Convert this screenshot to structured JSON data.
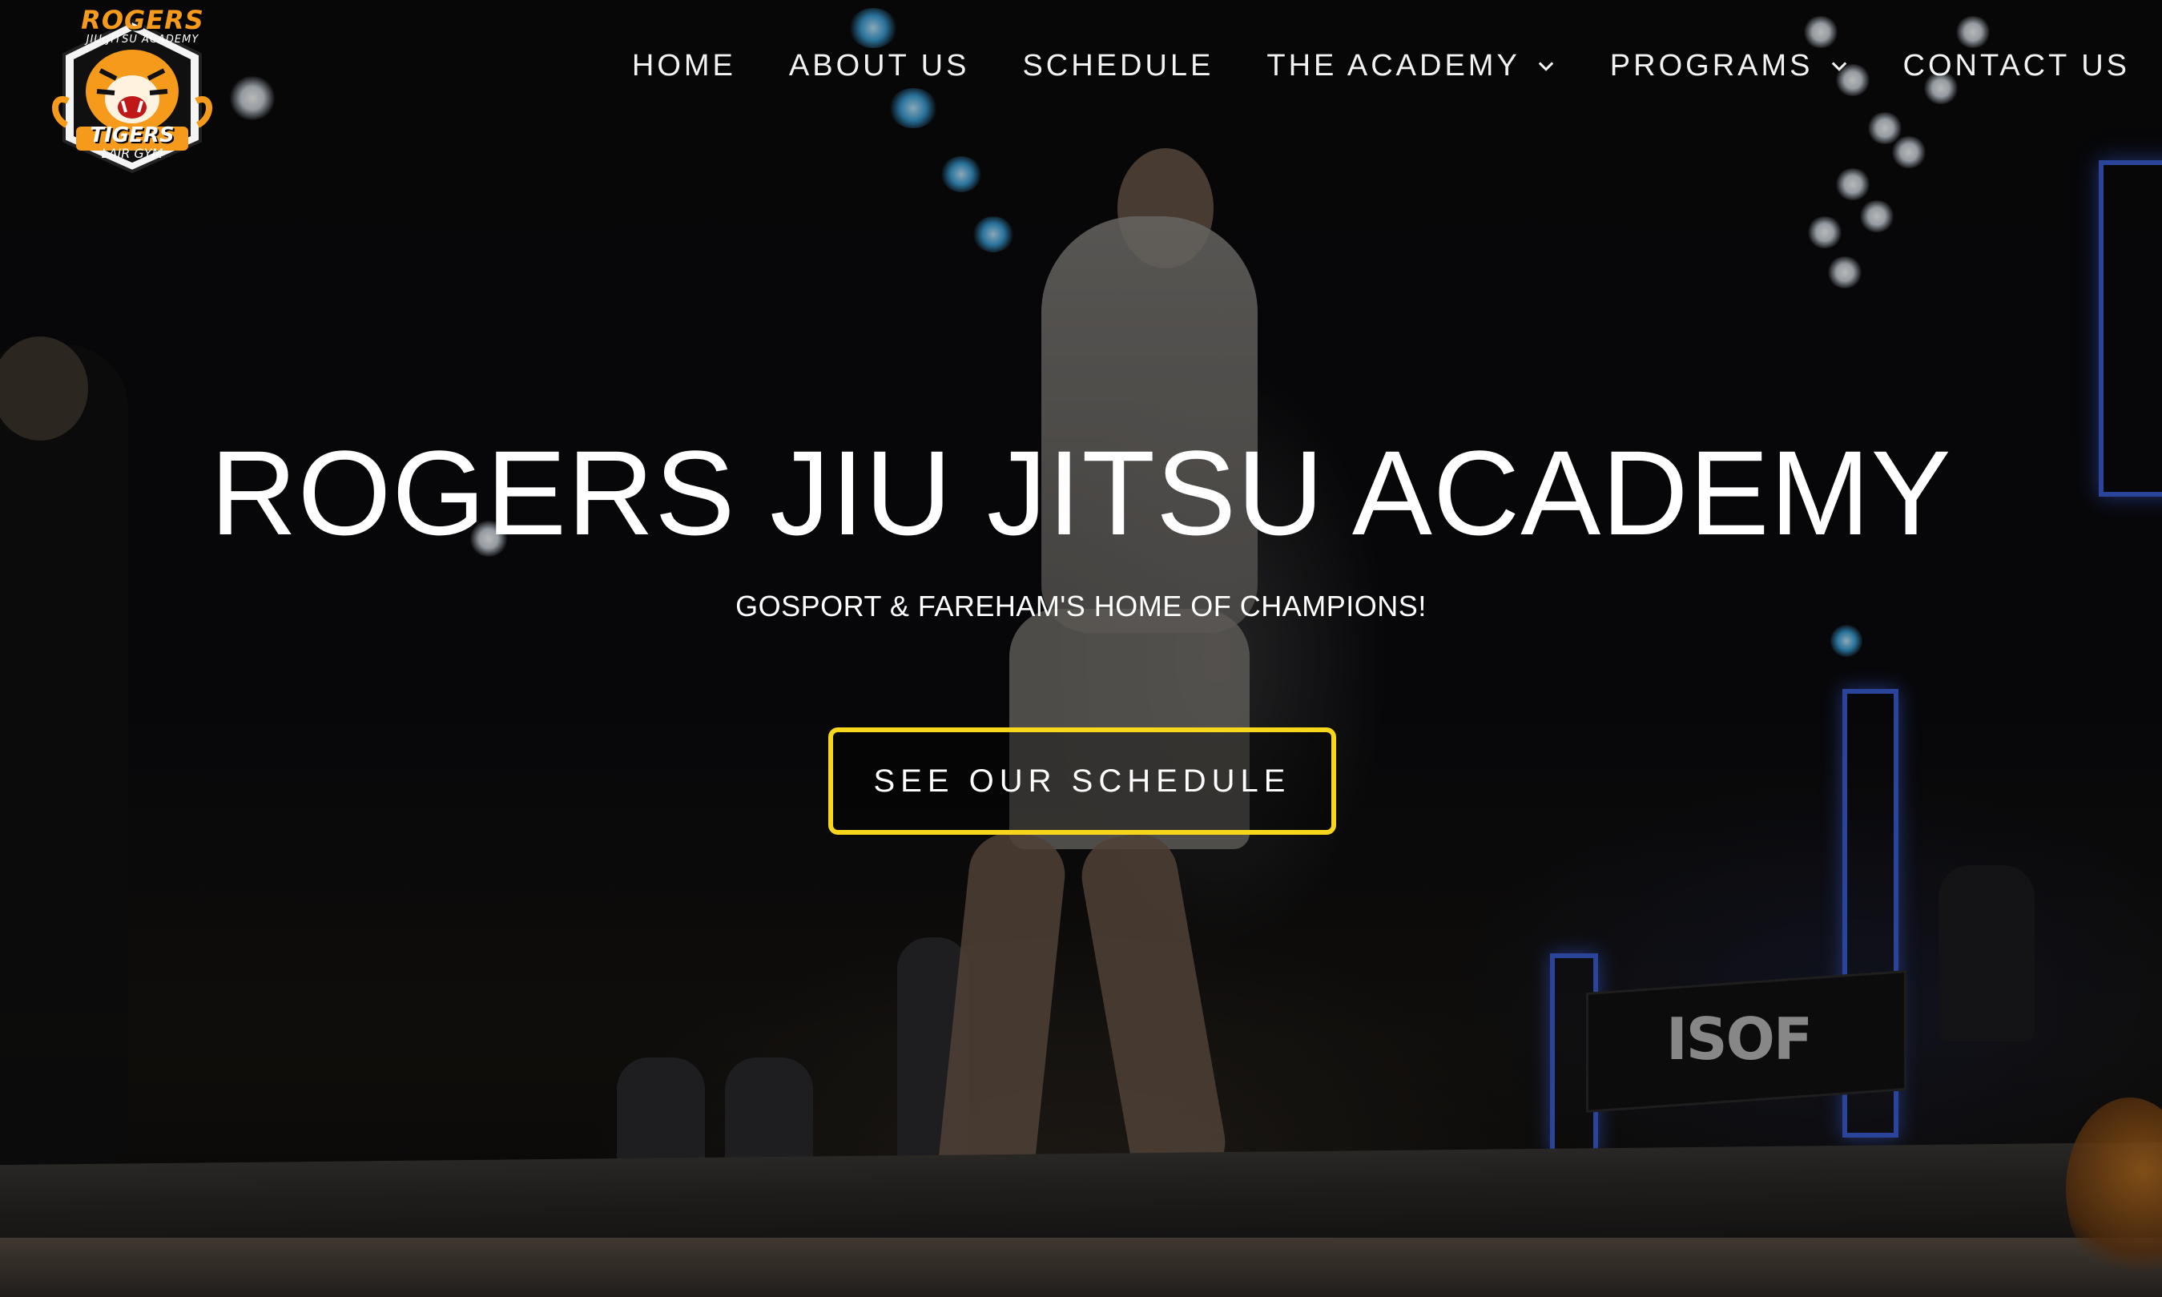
{
  "brand": {
    "logo_top": "ROGERS",
    "logo_sub": "JIU-JITSU ACADEMY",
    "logo_mid": "TIGERS",
    "logo_bottom": "LAIR GYM"
  },
  "nav": {
    "items": [
      {
        "label": "HOME",
        "has_dropdown": false
      },
      {
        "label": "ABOUT US",
        "has_dropdown": false
      },
      {
        "label": "SCHEDULE",
        "has_dropdown": false
      },
      {
        "label": "THE ACADEMY",
        "has_dropdown": true
      },
      {
        "label": "PROGRAMS",
        "has_dropdown": true
      },
      {
        "label": "CONTACT US",
        "has_dropdown": false
      }
    ]
  },
  "hero": {
    "title": "ROGERS JIU JITSU ACADEMY",
    "subtitle": "GOSPORT & FAREHAM'S HOME OF CHAMPIONS!",
    "cta_label": "SEE OUR SCHEDULE",
    "banner_text": "ISOF"
  },
  "colors": {
    "accent": "#f7d61b",
    "logo_orange": "#f59a1b",
    "text": "#ffffff"
  },
  "icons": {
    "dropdown": "chevron-down-icon"
  }
}
